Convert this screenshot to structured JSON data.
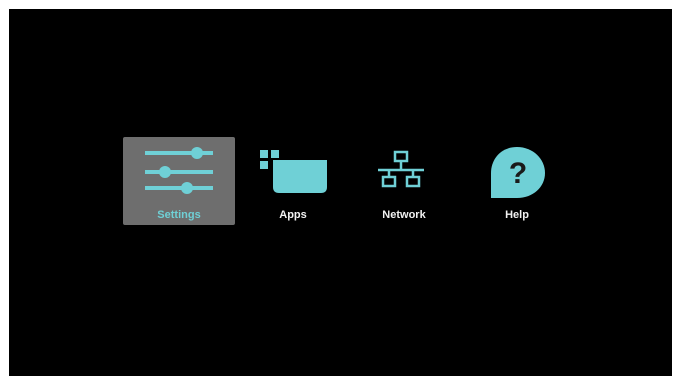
{
  "menu": {
    "accent_color": "#6fd0d6",
    "selected": "Settings",
    "items": [
      {
        "label": "Settings",
        "icon": "sliders-icon"
      },
      {
        "label": "Apps",
        "icon": "apps-icon"
      },
      {
        "label": "Network",
        "icon": "network-icon"
      },
      {
        "label": "Help",
        "icon": "help-icon"
      }
    ]
  }
}
